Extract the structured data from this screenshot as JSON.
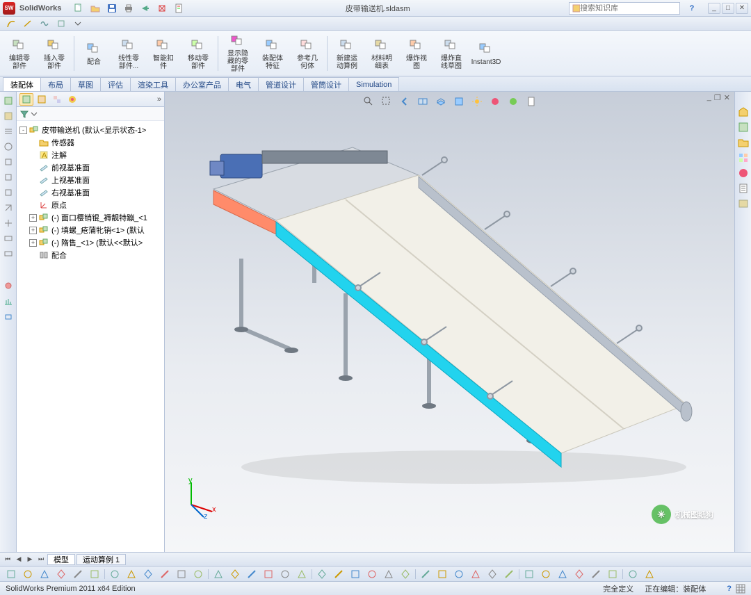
{
  "app": {
    "name": "SolidWorks",
    "doc_title": "皮带输送机.sldasm",
    "search_placeholder": "搜索知识库"
  },
  "win_controls": [
    "_",
    "□",
    "✕"
  ],
  "ribbon": [
    {
      "label": "编辑零\n部件"
    },
    {
      "label": "插入零\n部件"
    },
    {
      "label": "配合"
    },
    {
      "label": "线性零\n部件..."
    },
    {
      "label": "智能扣\n件"
    },
    {
      "label": "移动零\n部件"
    },
    {
      "label": "显示隐\n藏的零\n部件"
    },
    {
      "label": "装配体\n特征"
    },
    {
      "label": "参考几\n何体"
    },
    {
      "label": "新建运\n动算例"
    },
    {
      "label": "材料明\n细表"
    },
    {
      "label": "爆炸视\n图"
    },
    {
      "label": "爆炸直\n线草图"
    },
    {
      "label": "Instant3D"
    }
  ],
  "tabs": [
    "装配体",
    "布局",
    "草图",
    "评估",
    "渲染工具",
    "办公室产品",
    "电气",
    "管道设计",
    "管筒设计",
    "Simulation"
  ],
  "active_tab": 0,
  "tree": {
    "root": "皮带输送机  (默认<显示状态-1>",
    "nodes": [
      {
        "icon": "folder",
        "label": "传感器"
      },
      {
        "icon": "ann",
        "label": "注解"
      },
      {
        "icon": "plane",
        "label": "前视基准面"
      },
      {
        "icon": "plane",
        "label": "上视基准面"
      },
      {
        "icon": "plane",
        "label": "右视基准面"
      },
      {
        "icon": "origin",
        "label": "原点"
      },
      {
        "icon": "asm",
        "label": "(-) 面口樱销锟_褥靓特蹦_<1",
        "exp": "+"
      },
      {
        "icon": "asm",
        "label": "(-) 填螺_疮蒲牝销<1> (默认",
        "exp": "+"
      },
      {
        "icon": "asm",
        "label": "(-) 隋售_<1> (默认<<默认>",
        "exp": "+"
      },
      {
        "icon": "mates",
        "label": "配合"
      }
    ]
  },
  "bottom_tabs": [
    "模型",
    "运动算例 1"
  ],
  "status": {
    "left": "SolidWorks Premium 2011 x64 Edition",
    "mid": "完全定义",
    "right": "正在编辑：装配体"
  },
  "watermark": "机械图纸狗",
  "triad_axes": [
    "x",
    "y",
    "z"
  ],
  "colors": {
    "accent": "#2a6ac4",
    "conveyor_belt": "#f2f0e8",
    "rail_a": "#ff8b6a",
    "rail_b": "#22d3ee"
  }
}
